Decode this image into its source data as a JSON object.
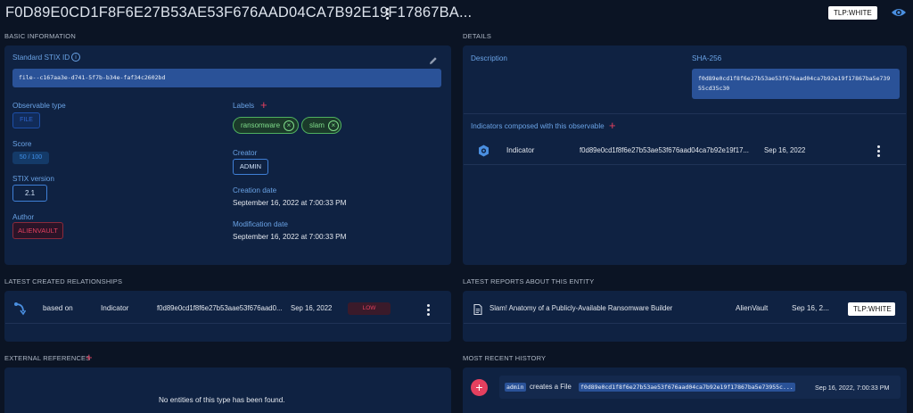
{
  "header": {
    "title": "F0D89E0CD1F8F6E27B53AE53F676AAD04CA7B92E19F17867BA...",
    "tlp": "TLP:WHITE"
  },
  "basic_info": {
    "section": "BASIC INFORMATION",
    "stix_id_label": "Standard STIX ID",
    "stix_id": "file--c167aa3e-d741-5f7b-b34e-faf34c2602bd",
    "observable_type_label": "Observable type",
    "observable_type": "FILE",
    "score_label": "Score",
    "score": "50 / 100",
    "stix_version_label": "STIX version",
    "stix_version": "2.1",
    "author_label": "Author",
    "author": "ALIENVAULT",
    "labels_label": "Labels",
    "labels": [
      "ransomware",
      "slam"
    ],
    "creator_label": "Creator",
    "creator": "ADMIN",
    "creation_date_label": "Creation date",
    "creation_date": "September 16, 2022 at 7:00:33 PM",
    "modification_date_label": "Modification date",
    "modification_date": "September 16, 2022 at 7:00:33 PM"
  },
  "details": {
    "section": "DETAILS",
    "description_label": "Description",
    "sha_label": "SHA-256",
    "sha_line1": "f0d89e0cd1f8f6e27b53ae53f676aad04ca7b92e19f17867ba5e739",
    "sha_line2": "55cd35c30",
    "indicators_label": "Indicators composed with this observable",
    "indicator": {
      "type": "Indicator",
      "name": "f0d89e0cd1f8f6e27b53ae53f676aad04ca7b92e19f17...",
      "date": "Sep 16, 2022"
    }
  },
  "relationships": {
    "section": "LATEST CREATED RELATIONSHIPS",
    "row": {
      "relation": "based on",
      "type": "Indicator",
      "name": "f0d89e0cd1f8f6e27b53aae53f676aad0...",
      "date": "Sep 16, 2022",
      "level": "LOW"
    }
  },
  "reports": {
    "section": "LATEST REPORTS ABOUT THIS ENTITY",
    "row": {
      "title": "Slam! Anatomy of a Publicly-Available Ransomware Builder",
      "author": "AlienVault",
      "date": "Sep 16, 2...",
      "tlp": "TLP:WHITE"
    }
  },
  "external": {
    "section": "EXTERNAL REFERENCES",
    "empty": "No entities of this type has been found."
  },
  "history": {
    "section": "MOST RECENT HISTORY",
    "user": "admin",
    "action": "creates a File",
    "target": "f0d89e0cd1f8f6e27b53ae53f676aad04ca7b92e19f17867ba5e73955c...",
    "date": "Sep 16, 2022, 7:00:33 PM"
  },
  "colors": {
    "background": "#0b1424",
    "panel": "#0f2242",
    "accent": "#6aa3e6",
    "danger": "#e4405f",
    "success": "#7fdc8a"
  }
}
